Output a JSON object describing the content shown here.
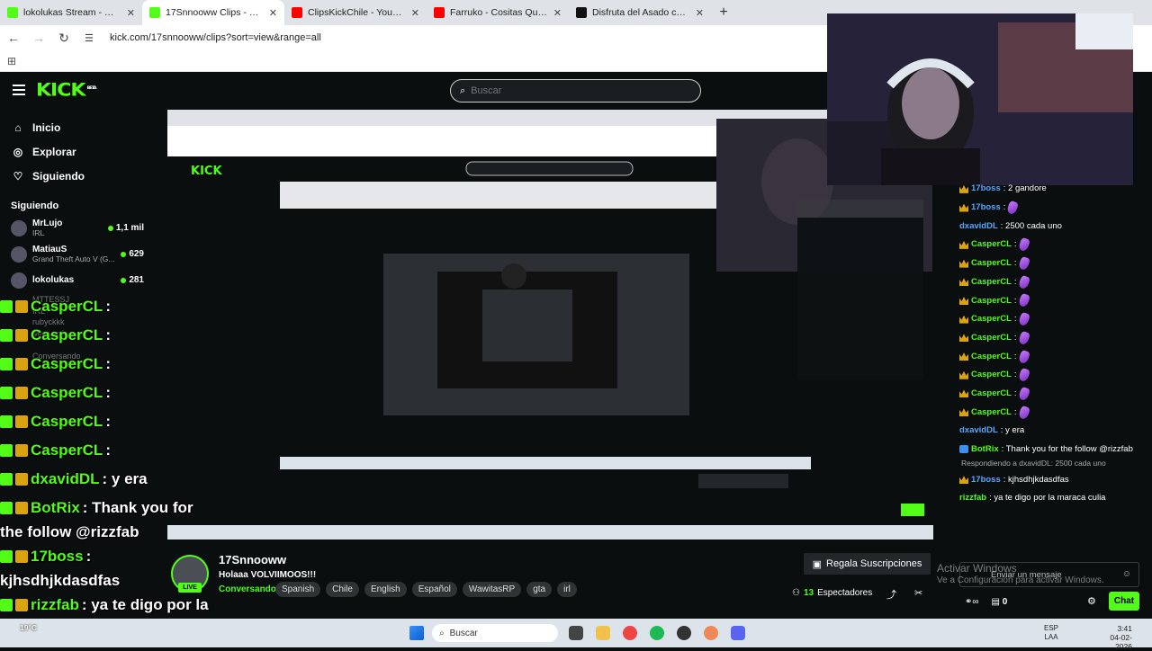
{
  "browser": {
    "tabs": [
      {
        "title": "lokolukas Stream - Watch Live o",
        "color": "#53fc18"
      },
      {
        "title": "17Snnooww Clips - Watch Live",
        "color": "#53fc18",
        "active": true
      },
      {
        "title": "ClipsKickChile - YouTube",
        "color": "#ff0000"
      },
      {
        "title": "Farruko - Cositas Que Haciamos",
        "color": "#ff0000"
      },
      {
        "title": "Disfruta del Asado con Román",
        "color": "#111111"
      }
    ],
    "url": "kick.com/17snnooww/clips?sort=view&range=all"
  },
  "kick": {
    "logo": "KICK",
    "logo_sup": "BETA",
    "search_placeholder": "Buscar",
    "nav": [
      {
        "label": "Inicio",
        "icon": "home-icon"
      },
      {
        "label": "Explorar",
        "icon": "compass-icon"
      },
      {
        "label": "Siguiendo",
        "icon": "heart-icon"
      }
    ],
    "following_title": "Siguiendo",
    "following": [
      {
        "name": "MrLujo",
        "category": "IRL",
        "viewers": "1,1 mil"
      },
      {
        "name": "MatiauS",
        "category": "Grand Theft Auto V (G...",
        "viewers": "629"
      },
      {
        "name": "lokolukas",
        "category": "",
        "viewers": "281"
      }
    ],
    "following_faded": [
      "MTTESSJ",
      "IRL",
      "rubyckkk",
      "Minecraft",
      "",
      "Conversando"
    ]
  },
  "overlay_chat": [
    {
      "user": "CasperCL",
      "text": " : "
    },
    {
      "user": "CasperCL",
      "text": " : "
    },
    {
      "user": "CasperCL",
      "text": " : "
    },
    {
      "user": "CasperCL",
      "text": " : "
    },
    {
      "user": "CasperCL",
      "text": " : "
    },
    {
      "user": "CasperCL",
      "text": " : "
    },
    {
      "user": "dxavidDL",
      "text": " : y era"
    },
    {
      "user": "BotRix",
      "text": " : Thank you for"
    },
    {
      "user": "",
      "text": "the follow @rizzfab"
    },
    {
      "user": "17boss",
      "text": " : "
    },
    {
      "user": "",
      "text": "kjhsdhjkdasdfas"
    },
    {
      "user": "rizzfab",
      "text": " : ya te digo por la"
    },
    {
      "user": "",
      "text": "maraca culia"
    }
  ],
  "chat": {
    "messages": [
      {
        "user": "17boss",
        "text": ": 2 gandore",
        "badge": "crown",
        "color": "#53a8ff"
      },
      {
        "user": "17boss",
        "text": ":",
        "badge": "crown",
        "color": "#53a8ff",
        "emote": true
      },
      {
        "user": "dxavidDL",
        "text": ": 2500 cada uno",
        "badge": "",
        "color": "#53a8ff"
      },
      {
        "user": "CasperCL",
        "text": ":",
        "badge": "crown",
        "color": "#53fc18",
        "emote": true
      },
      {
        "user": "CasperCL",
        "text": ":",
        "badge": "crown",
        "color": "#53fc18",
        "emote": true
      },
      {
        "user": "CasperCL",
        "text": ":",
        "badge": "crown",
        "color": "#53fc18",
        "emote": true
      },
      {
        "user": "CasperCL",
        "text": ":",
        "badge": "crown",
        "color": "#53fc18",
        "emote": true
      },
      {
        "user": "CasperCL",
        "text": ":",
        "badge": "crown",
        "color": "#53fc18",
        "emote": true
      },
      {
        "user": "CasperCL",
        "text": ":",
        "badge": "crown",
        "color": "#53fc18",
        "emote": true
      },
      {
        "user": "CasperCL",
        "text": ":",
        "badge": "crown",
        "color": "#53fc18",
        "emote": true
      },
      {
        "user": "CasperCL",
        "text": ":",
        "badge": "crown",
        "color": "#53fc18",
        "emote": true
      },
      {
        "user": "CasperCL",
        "text": ":",
        "badge": "crown",
        "color": "#53fc18",
        "emote": true
      },
      {
        "user": "CasperCL",
        "text": ":",
        "badge": "crown",
        "color": "#53fc18",
        "emote": true
      },
      {
        "user": "dxavidDL",
        "text": ": y era",
        "badge": "",
        "color": "#53a8ff"
      },
      {
        "user": "BotRix",
        "text": ": Thank you for the follow @rizzfab",
        "badge": "bot",
        "color": "#53fc18"
      }
    ],
    "reply_text": "Respondiendo a dxavidDL: 2500 cada uno",
    "messages2": [
      {
        "user": "17boss",
        "text": ": kjhsdhjkdasdfas",
        "badge": "crown",
        "color": "#53a8ff"
      },
      {
        "user": "rizzfab",
        "text": ": ya te digo por la maraca culia",
        "badge": "",
        "color": "#53fc18"
      }
    ],
    "input_placeholder": "Enviar un mensaje",
    "points": "0",
    "chat_button": "Chat"
  },
  "stream": {
    "name": "17Snnooww",
    "live_badge": "LIVE",
    "title": "Holaaa VOLVIIMOOS!!!",
    "category": "Conversando",
    "tags": [
      "Spanish",
      "Chile",
      "English",
      "Español",
      "WawitasRP",
      "gta",
      "irl"
    ],
    "gift_button": "Regala Suscripciones",
    "viewers_count": "13",
    "viewers_label": "Espectadores"
  },
  "windows_watermark": {
    "line1": "Activar Windows",
    "line2": "Ve a Configuración para activar Windows."
  },
  "taskbar": {
    "weather": "19°C",
    "search": "Buscar",
    "lang1": "ESP",
    "lang2": "LAA",
    "time": "3:41",
    "date": "04-02-2026"
  }
}
